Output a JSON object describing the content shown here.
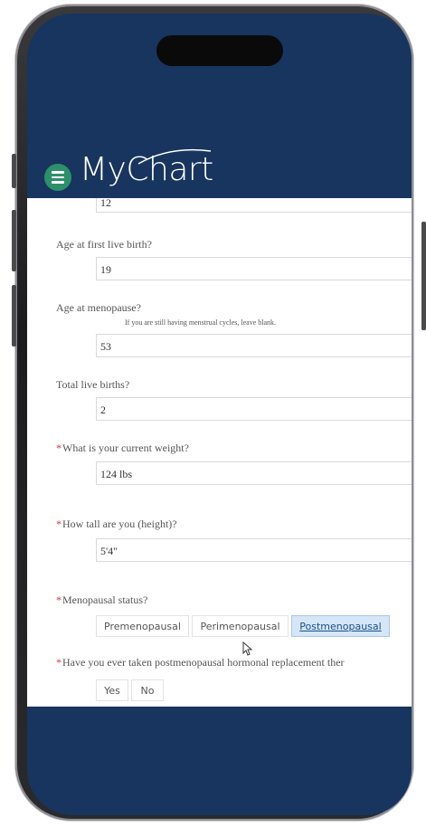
{
  "app": {
    "logo_text": "MyChart"
  },
  "form": {
    "prev_value": "12",
    "questions": [
      {
        "label": "Age at first live birth?",
        "required": false,
        "hint": "",
        "value": "19"
      },
      {
        "label": "Age at menopause?",
        "required": false,
        "hint": "If you are still having menstrual cycles, leave blank.",
        "value": "53"
      },
      {
        "label": "Total live births?",
        "required": false,
        "hint": "",
        "value": "2"
      },
      {
        "label": "What is your current weight?",
        "required": true,
        "hint": "",
        "value": "124 lbs"
      },
      {
        "label": "How tall are you (height)?",
        "required": true,
        "hint": "",
        "value": "5'4\""
      }
    ],
    "menopausal": {
      "label": "Menopausal status?",
      "required": true,
      "options": [
        "Premenopausal",
        "Perimenopausal",
        "Postmenopausal"
      ],
      "selected": "Postmenopausal"
    },
    "hrt": {
      "label": "Have you ever taken postmenopausal hormonal replacement ther",
      "required": true,
      "options": [
        "Yes",
        "No"
      ]
    }
  },
  "colors": {
    "header_bg": "#17355e",
    "menu_button": "#2e8f6b",
    "required_marker": "#d0334b",
    "selected_option_bg": "#d5e6f7"
  },
  "icons": {
    "menu": "hamburger-menu-icon",
    "pointer": "mouse-pointer-icon"
  }
}
